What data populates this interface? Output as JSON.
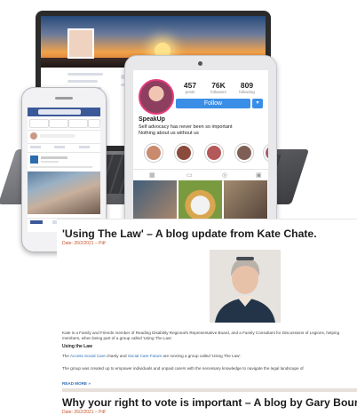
{
  "instagram": {
    "stats": [
      {
        "num": "457",
        "label": "posts"
      },
      {
        "num": "76K",
        "label": "followers"
      },
      {
        "num": "809",
        "label": "following"
      }
    ],
    "follow_label": "Follow",
    "dropdown_label": "▾",
    "name": "SpeakUp",
    "bio_line1": "Self advocacy has never been so important",
    "bio_line2": "Nothing about us without us"
  },
  "blog": {
    "post1": {
      "title": "'Using The Law' – A blog update from Kate Chate.",
      "meta": "Date: 26/2/2021 – Pdf",
      "intro": "Kate is a Family and Friends member of Reading Disability Regional's Representative Board, and a Family Consultant for Discussions of Legions, helping members, when being part of a group called 'Using The Law'.",
      "heading": "Using the Law",
      "line_prefix": "The ",
      "line_link1": "Access Social Care",
      "line_mid": " charity and ",
      "line_link2": "Social Care Future",
      "line_suffix": " are running a group called 'Using The Law'.",
      "line2": "The group was created up to empower individuals and unpaid carers with the necessary knowledge to navigate the legal landscape of",
      "readmore": "READ MORE »"
    },
    "post2": {
      "title": "Why your right to vote is important – A blog by Gary Bourlet.",
      "meta": "Date: 26/2/2021 – Pdf"
    }
  }
}
